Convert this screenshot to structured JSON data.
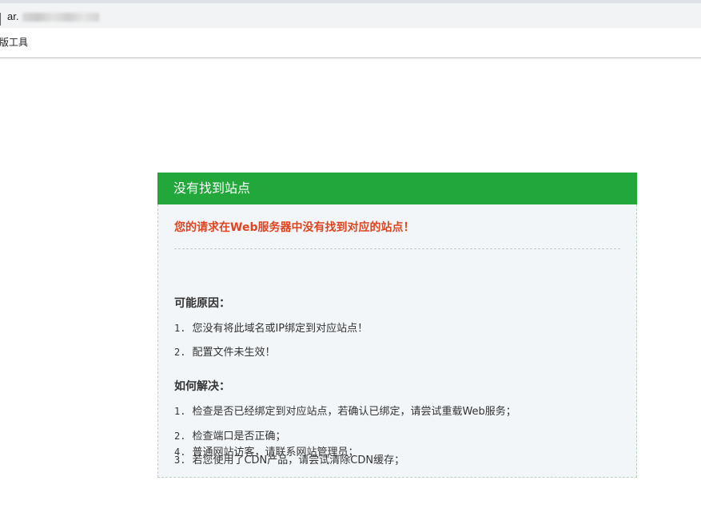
{
  "browser": {
    "url_prefix": "ar.",
    "bookmark_label": "版工具"
  },
  "panel": {
    "title": "没有找到站点",
    "error_message": "您的请求在Web服务器中没有找到对应的站点！",
    "reasons_title": "可能原因：",
    "reasons": [
      {
        "num": "1.",
        "text": "您没有将此域名或IP绑定到对应站点！"
      },
      {
        "num": "2.",
        "text": "配置文件未生效！"
      }
    ],
    "solutions_title": "如何解决：",
    "solutions": [
      {
        "num": "1.",
        "text": "检查是否已经绑定到对应站点，若确认已绑定，请尝试重载Web服务；"
      },
      {
        "num": "2.",
        "text": "检查端口是否正确；"
      },
      {
        "num": "3.",
        "text": "若您使用了CDN产品，请尝试清除CDN缓存；"
      },
      {
        "num": "4.",
        "text": "普通网站访客，请联系网站管理员；"
      }
    ],
    "colors": {
      "header_bg": "#22a73b",
      "error_text": "#e0441f",
      "body_bg": "#f3f6f9"
    }
  }
}
